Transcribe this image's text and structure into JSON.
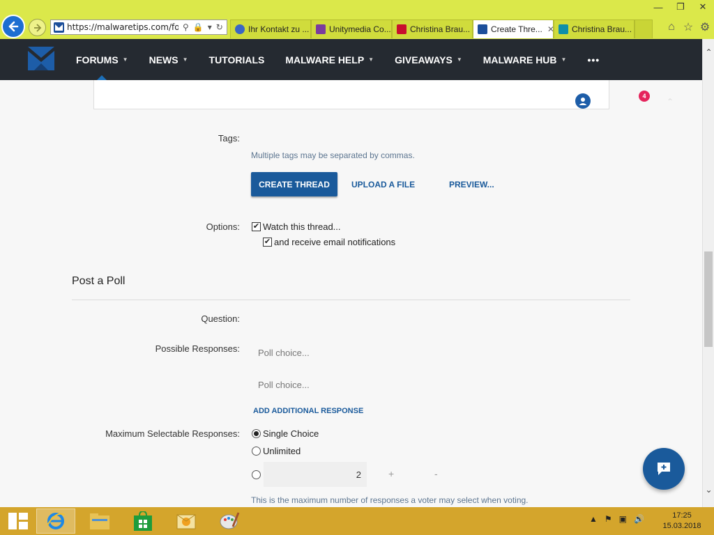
{
  "browser": {
    "url": "https://malwaretips.com/foru",
    "tabs": [
      {
        "label": "Ihr Kontakt zu ...",
        "active": false,
        "color": "#3a66c4"
      },
      {
        "label": "Unitymedia Co...",
        "active": false,
        "color": "#7a3c9e"
      },
      {
        "label": "Christina Brau...",
        "active": false,
        "color": "#c8102e"
      },
      {
        "label": "Create Thre...",
        "active": true,
        "color": "#1d4f9a"
      },
      {
        "label": "Christina Brau...",
        "active": false,
        "color": "#0f8fa8"
      }
    ],
    "window_controls": [
      "minimize-icon",
      "restore-icon",
      "close-icon"
    ],
    "right_tools": [
      "home-icon",
      "star-icon",
      "gear-icon"
    ]
  },
  "site_nav": {
    "items": [
      {
        "label": "FORUMS",
        "dropdown": true
      },
      {
        "label": "NEWS",
        "dropdown": true
      },
      {
        "label": "TUTORIALS",
        "dropdown": false
      },
      {
        "label": "MALWARE HELP",
        "dropdown": true
      },
      {
        "label": "GIVEAWAYS",
        "dropdown": true
      },
      {
        "label": "MALWARE HUB",
        "dropdown": true
      }
    ],
    "more": "•••"
  },
  "header_tools": {
    "notification_count": "4"
  },
  "form": {
    "tags_label": "Tags:",
    "tags_hint": "Multiple tags may be separated by commas.",
    "create_thread": "CREATE THREAD",
    "upload_file": "UPLOAD A FILE",
    "preview": "PREVIEW...",
    "options_label": "Options:",
    "watch_thread": "Watch this thread...",
    "email_notifications": "and receive email notifications"
  },
  "poll": {
    "title": "Post a Poll",
    "question_label": "Question:",
    "responses_label": "Possible Responses:",
    "choice_placeholder_1": "Poll choice...",
    "choice_placeholder_2": "Poll choice...",
    "add_response": "ADD ADDITIONAL RESPONSE",
    "max_label": "Maximum Selectable Responses:",
    "single_choice": "Single Choice",
    "unlimited": "Unlimited",
    "custom_value": "2",
    "increment": "+",
    "decrement": "-",
    "max_hint": "This is the maximum number of responses a voter may select when voting."
  },
  "taskbar": {
    "apps": [
      "internet-explorer-icon",
      "file-explorer-icon",
      "store-icon",
      "outlook-icon",
      "paint-icon"
    ],
    "time": "17:25",
    "date": "15.03.2018"
  },
  "colors": {
    "accent": "#1a5a9b",
    "nav_bg": "#252a31",
    "chrome_bg": "#dbe84a",
    "taskbar_bg": "#d4a52c",
    "badge": "#e5245c"
  }
}
